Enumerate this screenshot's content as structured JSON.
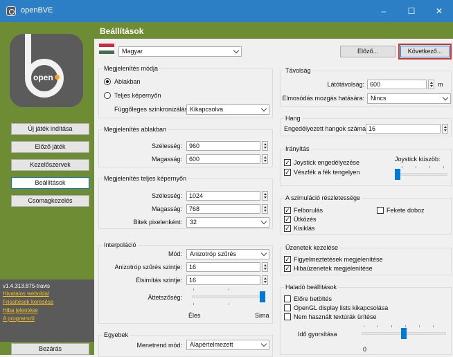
{
  "window": {
    "title": "openBVE",
    "minimize_glyph": "–",
    "maximize_glyph": "☐",
    "close_glyph": "✕"
  },
  "sidebar": {
    "logo_text": "open",
    "buttons": [
      "Új játék indítása",
      "Előző játék",
      "Kezelőszervek",
      "Beállítások",
      "Csomagkezelés"
    ],
    "active_index": 3,
    "version": "v1.4.313.875-travis",
    "links": [
      "Hivatalos weboldal",
      "Frissítések keresése",
      "Hiba jelentése",
      "A programról"
    ],
    "close_label": "Bezárás"
  },
  "header": {
    "title": "Beállítások"
  },
  "language": {
    "selected": "Magyar",
    "flag_colors": [
      "#cd2a3e",
      "#ffffff",
      "#436f4d"
    ]
  },
  "nav": {
    "prev": "Előző...",
    "next": "Következő..."
  },
  "display_mode": {
    "title": "Megjelenítés módja",
    "windowed": "Ablakban",
    "fullscreen": "Teljes képernyőn",
    "selected": "windowed",
    "vsync_label": "Függőleges szinkronizálás:",
    "vsync_value": "Kikapcsolva"
  },
  "windowed": {
    "title": "Megjelenítés ablakban",
    "width_label": "Szélesség:",
    "width": "960",
    "height_label": "Magasság:",
    "height": "600"
  },
  "fullscreen": {
    "title": "Megjelenítés teljes képernyőn",
    "width_label": "Szélesség:",
    "width": "1024",
    "height_label": "Magasság:",
    "height": "768",
    "bpp_label": "Bitek pixelenként:",
    "bpp": "32"
  },
  "interpolation": {
    "title": "Interpoláció",
    "mode_label": "Mód:",
    "mode": "Anizotróp szűrés",
    "aniso_label": "Anizotróp szűrés szintje:",
    "aniso": "16",
    "aa_label": "Élsimítás szintje:",
    "aa": "16",
    "transparency_label": "Áttetszőség:",
    "transparency_level": 1.0,
    "left_label": "Éles",
    "right_label": "Sima"
  },
  "misc": {
    "title": "Egyebek",
    "timetable_label": "Menetrend mód:",
    "timetable": "Alapértelmezett"
  },
  "distance": {
    "title": "Távolság",
    "view_label": "Látótávolság:",
    "view": "600",
    "unit": "m",
    "blur_label": "Elmosódás mozgás hatására:",
    "blur": "Nincs"
  },
  "sound": {
    "title": "Hang",
    "max_label": "Engedélyezett hangok száma:",
    "max": "16"
  },
  "controls": {
    "title": "Irányítás",
    "joystick_label": "Joystick engedélyezése",
    "joystick_checked": true,
    "brake_label": "Vészfék a fék tengelyen",
    "brake_checked": true,
    "threshold_label": "Joystick küszöb:",
    "threshold_level": 0.0
  },
  "simulation": {
    "title": "A szimuláció részletessége",
    "items": [
      {
        "label": "Felborulás",
        "checked": true
      },
      {
        "label": "Ütközés",
        "checked": true
      },
      {
        "label": "Kisiklás",
        "checked": true
      },
      {
        "label": "Fekete doboz",
        "checked": false
      }
    ]
  },
  "messages": {
    "title": "Üzenetek kezelése",
    "items": [
      {
        "label": "Figyelmeztetések megjelenítése",
        "checked": true
      },
      {
        "label": "Hibaüzenetek megjelenítése",
        "checked": true
      }
    ]
  },
  "advanced": {
    "title": "Haladó beállítások",
    "items": [
      {
        "label": "Előre betöltés",
        "checked": false
      },
      {
        "label": "OpenGL display lists kikapcsolása",
        "checked": false
      },
      {
        "label": "Nem használt textúrák ürítése",
        "checked": false
      }
    ],
    "speed_label": "Idő gyorsítása",
    "speed_value": "0",
    "speed_level": 0.0
  },
  "icons": {
    "check": "✓"
  }
}
